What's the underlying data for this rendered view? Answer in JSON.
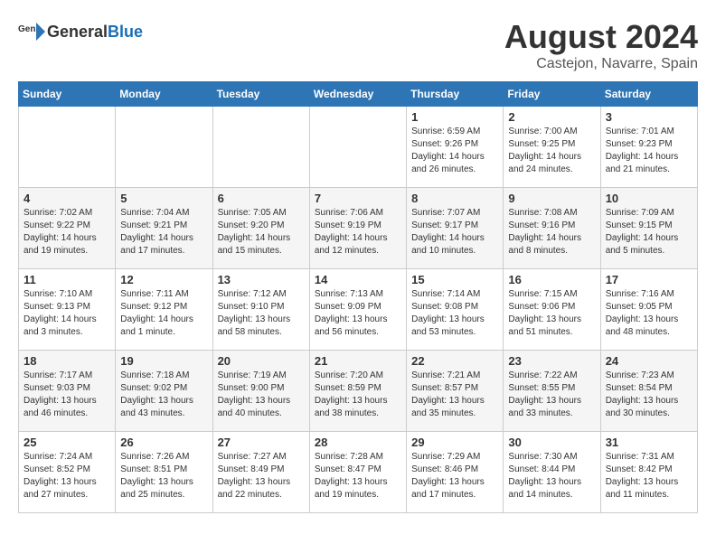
{
  "header": {
    "logo_general": "General",
    "logo_blue": "Blue",
    "month": "August 2024",
    "location": "Castejon, Navarre, Spain"
  },
  "days_of_week": [
    "Sunday",
    "Monday",
    "Tuesday",
    "Wednesday",
    "Thursday",
    "Friday",
    "Saturday"
  ],
  "weeks": [
    [
      {
        "day": "",
        "info": ""
      },
      {
        "day": "",
        "info": ""
      },
      {
        "day": "",
        "info": ""
      },
      {
        "day": "",
        "info": ""
      },
      {
        "day": "1",
        "info": "Sunrise: 6:59 AM\nSunset: 9:26 PM\nDaylight: 14 hours\nand 26 minutes."
      },
      {
        "day": "2",
        "info": "Sunrise: 7:00 AM\nSunset: 9:25 PM\nDaylight: 14 hours\nand 24 minutes."
      },
      {
        "day": "3",
        "info": "Sunrise: 7:01 AM\nSunset: 9:23 PM\nDaylight: 14 hours\nand 21 minutes."
      }
    ],
    [
      {
        "day": "4",
        "info": "Sunrise: 7:02 AM\nSunset: 9:22 PM\nDaylight: 14 hours\nand 19 minutes."
      },
      {
        "day": "5",
        "info": "Sunrise: 7:04 AM\nSunset: 9:21 PM\nDaylight: 14 hours\nand 17 minutes."
      },
      {
        "day": "6",
        "info": "Sunrise: 7:05 AM\nSunset: 9:20 PM\nDaylight: 14 hours\nand 15 minutes."
      },
      {
        "day": "7",
        "info": "Sunrise: 7:06 AM\nSunset: 9:19 PM\nDaylight: 14 hours\nand 12 minutes."
      },
      {
        "day": "8",
        "info": "Sunrise: 7:07 AM\nSunset: 9:17 PM\nDaylight: 14 hours\nand 10 minutes."
      },
      {
        "day": "9",
        "info": "Sunrise: 7:08 AM\nSunset: 9:16 PM\nDaylight: 14 hours\nand 8 minutes."
      },
      {
        "day": "10",
        "info": "Sunrise: 7:09 AM\nSunset: 9:15 PM\nDaylight: 14 hours\nand 5 minutes."
      }
    ],
    [
      {
        "day": "11",
        "info": "Sunrise: 7:10 AM\nSunset: 9:13 PM\nDaylight: 14 hours\nand 3 minutes."
      },
      {
        "day": "12",
        "info": "Sunrise: 7:11 AM\nSunset: 9:12 PM\nDaylight: 14 hours\nand 1 minute."
      },
      {
        "day": "13",
        "info": "Sunrise: 7:12 AM\nSunset: 9:10 PM\nDaylight: 13 hours\nand 58 minutes."
      },
      {
        "day": "14",
        "info": "Sunrise: 7:13 AM\nSunset: 9:09 PM\nDaylight: 13 hours\nand 56 minutes."
      },
      {
        "day": "15",
        "info": "Sunrise: 7:14 AM\nSunset: 9:08 PM\nDaylight: 13 hours\nand 53 minutes."
      },
      {
        "day": "16",
        "info": "Sunrise: 7:15 AM\nSunset: 9:06 PM\nDaylight: 13 hours\nand 51 minutes."
      },
      {
        "day": "17",
        "info": "Sunrise: 7:16 AM\nSunset: 9:05 PM\nDaylight: 13 hours\nand 48 minutes."
      }
    ],
    [
      {
        "day": "18",
        "info": "Sunrise: 7:17 AM\nSunset: 9:03 PM\nDaylight: 13 hours\nand 46 minutes."
      },
      {
        "day": "19",
        "info": "Sunrise: 7:18 AM\nSunset: 9:02 PM\nDaylight: 13 hours\nand 43 minutes."
      },
      {
        "day": "20",
        "info": "Sunrise: 7:19 AM\nSunset: 9:00 PM\nDaylight: 13 hours\nand 40 minutes."
      },
      {
        "day": "21",
        "info": "Sunrise: 7:20 AM\nSunset: 8:59 PM\nDaylight: 13 hours\nand 38 minutes."
      },
      {
        "day": "22",
        "info": "Sunrise: 7:21 AM\nSunset: 8:57 PM\nDaylight: 13 hours\nand 35 minutes."
      },
      {
        "day": "23",
        "info": "Sunrise: 7:22 AM\nSunset: 8:55 PM\nDaylight: 13 hours\nand 33 minutes."
      },
      {
        "day": "24",
        "info": "Sunrise: 7:23 AM\nSunset: 8:54 PM\nDaylight: 13 hours\nand 30 minutes."
      }
    ],
    [
      {
        "day": "25",
        "info": "Sunrise: 7:24 AM\nSunset: 8:52 PM\nDaylight: 13 hours\nand 27 minutes."
      },
      {
        "day": "26",
        "info": "Sunrise: 7:26 AM\nSunset: 8:51 PM\nDaylight: 13 hours\nand 25 minutes."
      },
      {
        "day": "27",
        "info": "Sunrise: 7:27 AM\nSunset: 8:49 PM\nDaylight: 13 hours\nand 22 minutes."
      },
      {
        "day": "28",
        "info": "Sunrise: 7:28 AM\nSunset: 8:47 PM\nDaylight: 13 hours\nand 19 minutes."
      },
      {
        "day": "29",
        "info": "Sunrise: 7:29 AM\nSunset: 8:46 PM\nDaylight: 13 hours\nand 17 minutes."
      },
      {
        "day": "30",
        "info": "Sunrise: 7:30 AM\nSunset: 8:44 PM\nDaylight: 13 hours\nand 14 minutes."
      },
      {
        "day": "31",
        "info": "Sunrise: 7:31 AM\nSunset: 8:42 PM\nDaylight: 13 hours\nand 11 minutes."
      }
    ]
  ]
}
